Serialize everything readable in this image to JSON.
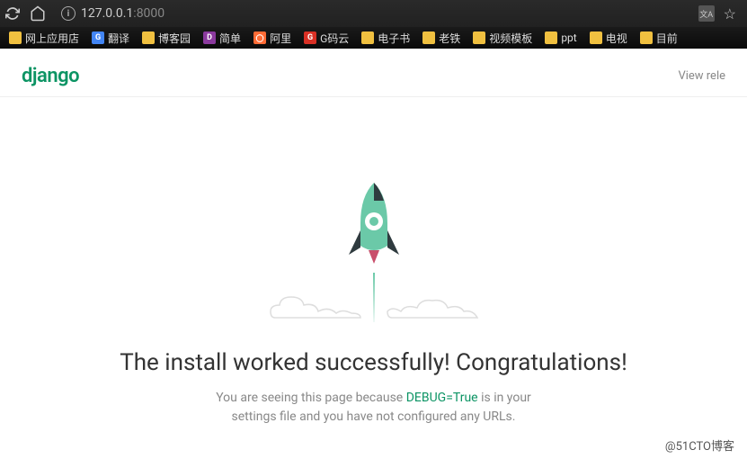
{
  "browser": {
    "url_host": "127.0.0.1",
    "url_port": ":8000"
  },
  "bookmarks": [
    {
      "label": "网上应用店",
      "icon_color": "folder"
    },
    {
      "label": "翻译",
      "icon_color": "google",
      "glyph": "G"
    },
    {
      "label": "博客园",
      "icon_color": "folder"
    },
    {
      "label": "简单",
      "icon_color": "purple",
      "glyph": "D"
    },
    {
      "label": "阿里",
      "icon_color": "orange",
      "glyph": "〇"
    },
    {
      "label": "G码云",
      "icon_color": "red-g",
      "glyph": "G"
    },
    {
      "label": "电子书",
      "icon_color": "folder"
    },
    {
      "label": "老铁",
      "icon_color": "folder"
    },
    {
      "label": "视频模板",
      "icon_color": "folder"
    },
    {
      "label": "ppt",
      "icon_color": "folder"
    },
    {
      "label": "电视",
      "icon_color": "folder"
    },
    {
      "label": "目前",
      "icon_color": "folder"
    }
  ],
  "page": {
    "logo": "django",
    "view_link": "View rele",
    "title": "The install worked successfully! Congratulations!",
    "sub_pre": "You are seeing this page because ",
    "debug": "DEBUG=True",
    "sub_post": " is in your settings file and you have not configured any URLs."
  },
  "watermark": "@51CTO博客",
  "colors": {
    "django_green": "#0C9464",
    "rocket_body": "#6BC9A8",
    "rocket_dark": "#2F3B3F"
  }
}
